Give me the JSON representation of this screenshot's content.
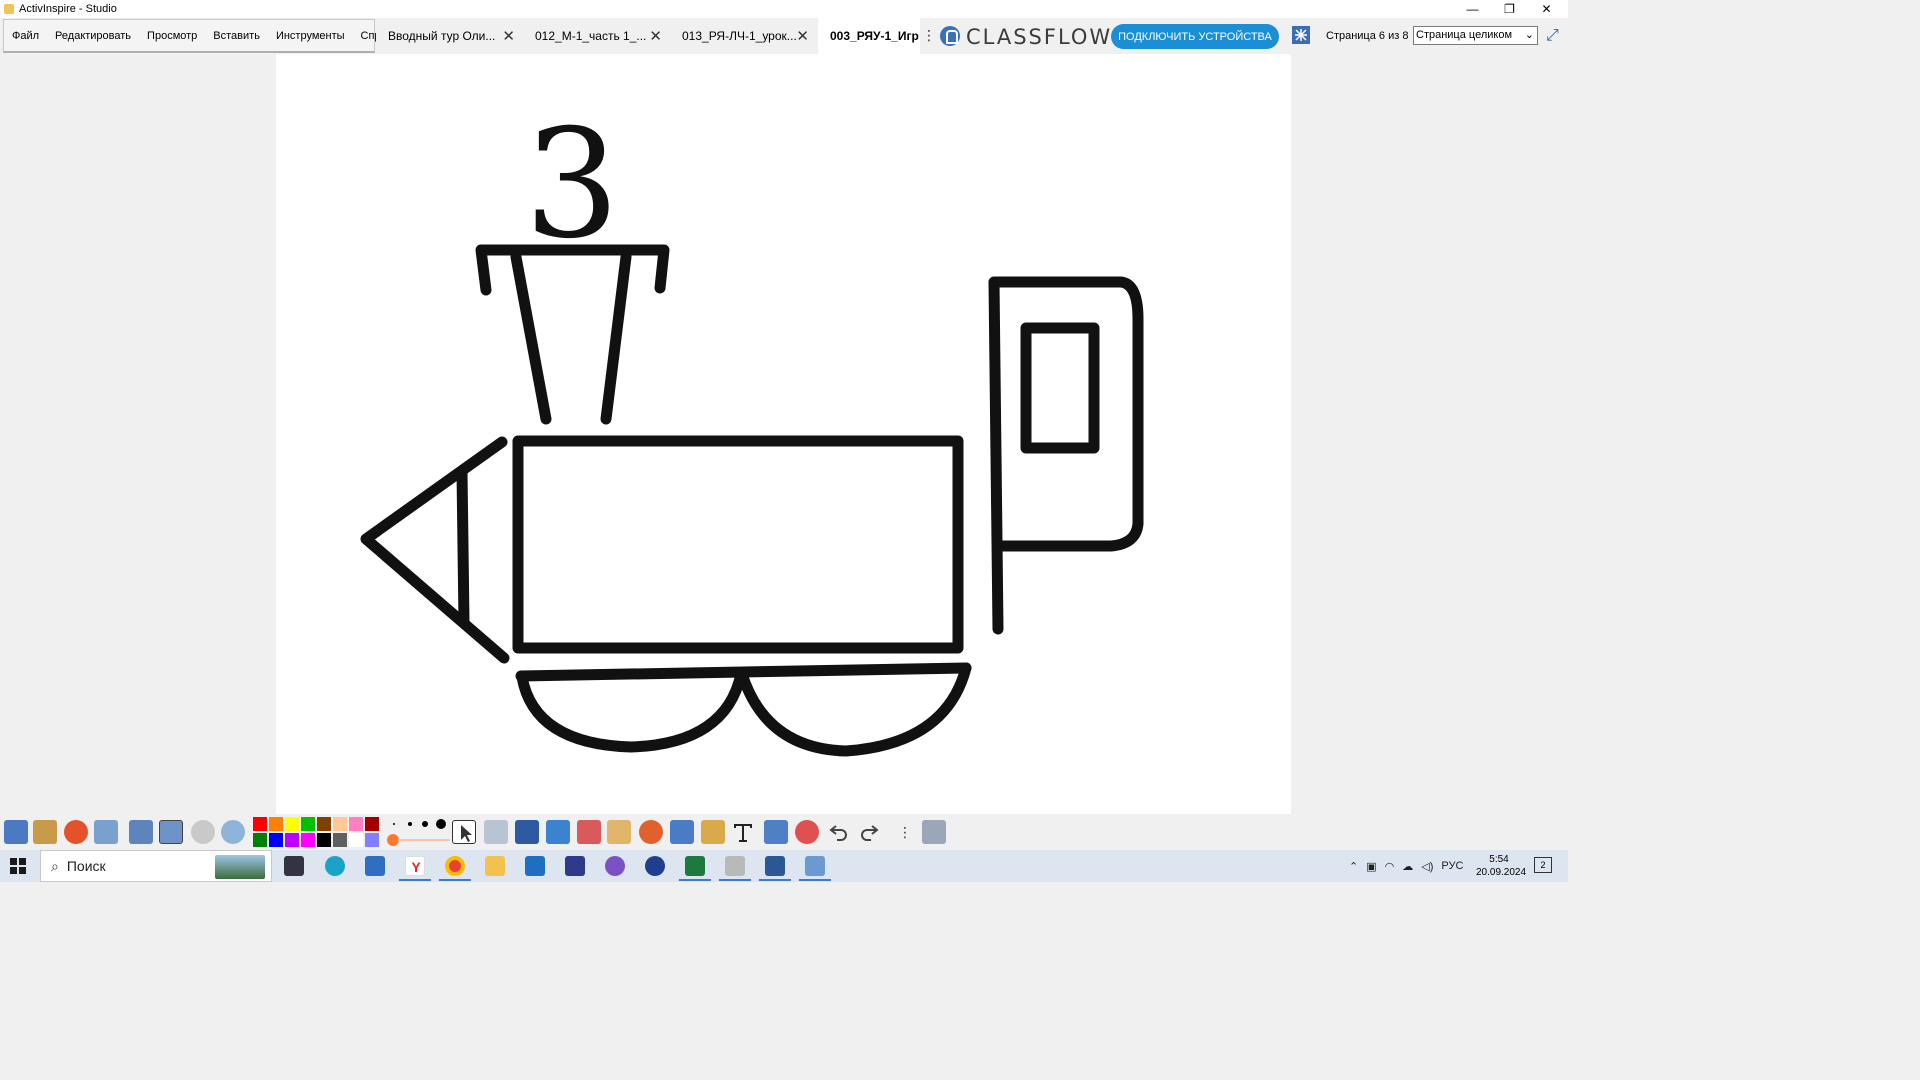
{
  "window": {
    "title": "ActivInspire - Studio",
    "minimize": "—",
    "restore": "❐",
    "close": "✕"
  },
  "menu": [
    "Файл",
    "Редактировать",
    "Просмотр",
    "Вставить",
    "Инструменты",
    "Справка"
  ],
  "tabs": [
    {
      "label": "Вводный тур Оли...",
      "active": false
    },
    {
      "label": "012_М-1_часть 1_...",
      "active": false
    },
    {
      "label": "013_РЯ-ЛЧ-1_урок...",
      "active": false
    },
    {
      "label": "003_РЯУ-1_Игр",
      "active": true
    }
  ],
  "tab_close": "✕",
  "tab_more": "⋮",
  "brand": {
    "logo_text": "CLASSFLOW",
    "trademark": "®"
  },
  "connect_button": "ПОДКЛЮЧИТЬ УСТРОЙСТВА",
  "page_indicator": "Страница 6 из 8",
  "zoom": {
    "value": "Страница целиком",
    "chevron": "⌄"
  },
  "expand": "⤢",
  "canvas": {
    "drawing_text": "3"
  },
  "palette": {
    "row1": [
      "#ff0000",
      "#ff8000",
      "#ffff00",
      "#00c000",
      "#804000",
      "#ffc896",
      "#ff80c0",
      "#a00000"
    ],
    "row2": [
      "#008000",
      "#0000ff",
      "#c000ff",
      "#ff00ff",
      "#000000",
      "#606060",
      "#ffffff",
      "#8080ff"
    ]
  },
  "pen_width_indicator": "#ff7a30",
  "taskbar": {
    "search_placeholder": "Поиск",
    "search_icon": "⌕",
    "language": "РУС",
    "time": "5:54",
    "date": "20.09.2024",
    "notifications": "2",
    "tray_up_arrow": "⌃"
  }
}
